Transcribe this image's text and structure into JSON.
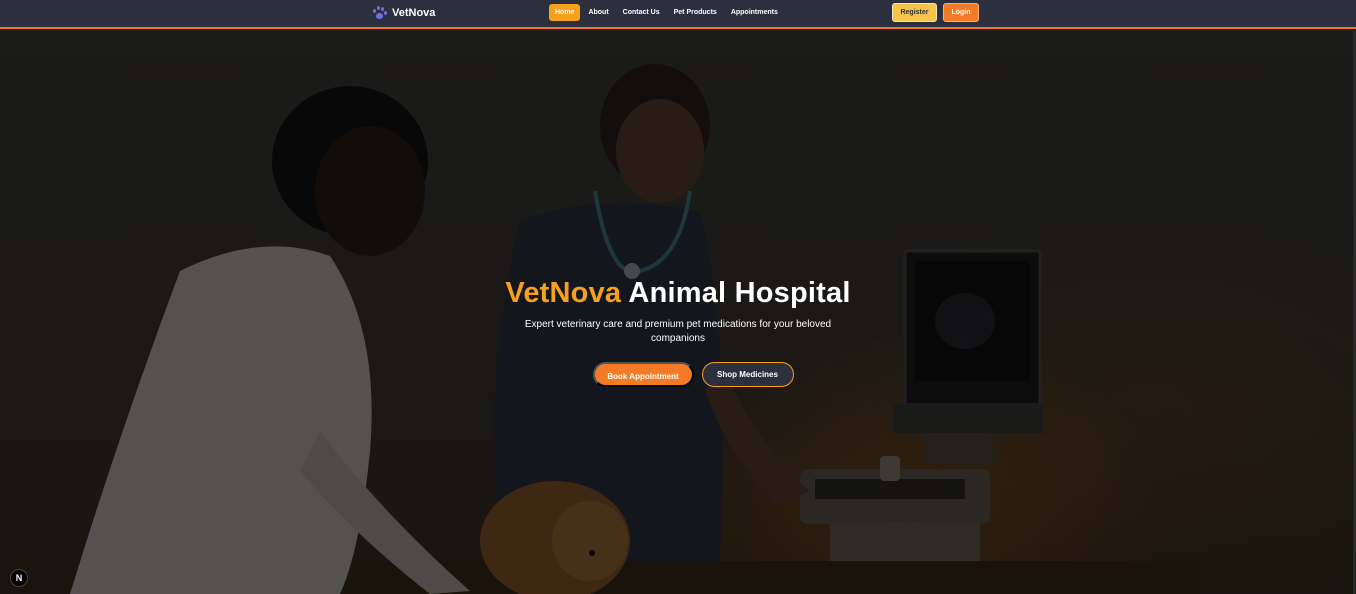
{
  "brand": {
    "name": "VetNova",
    "icon": "paw-icon"
  },
  "nav": {
    "links": [
      {
        "label": "Home",
        "active": true
      },
      {
        "label": "About",
        "active": false
      },
      {
        "label": "Contact Us",
        "active": false
      },
      {
        "label": "Pet Products",
        "active": false
      },
      {
        "label": "Appointments",
        "active": false
      }
    ],
    "register_label": "Register",
    "login_label": "Login"
  },
  "hero": {
    "title_accent": "VetNova",
    "title_rest": " Animal Hospital",
    "subtitle": "Expert veterinary care and premium pet medications for your beloved companions",
    "book_label": "Book Appointment",
    "shop_label": "Shop Medicines",
    "background": "photo of two veterinarians examining a pomeranian dog next to an ultrasound machine"
  },
  "badge": {
    "label": "N"
  },
  "colors": {
    "navbar": "#2c2f3e",
    "accent_orange": "#f47b25",
    "accent_yellow": "#f7a01c",
    "register_bg": "#f5c54a"
  }
}
